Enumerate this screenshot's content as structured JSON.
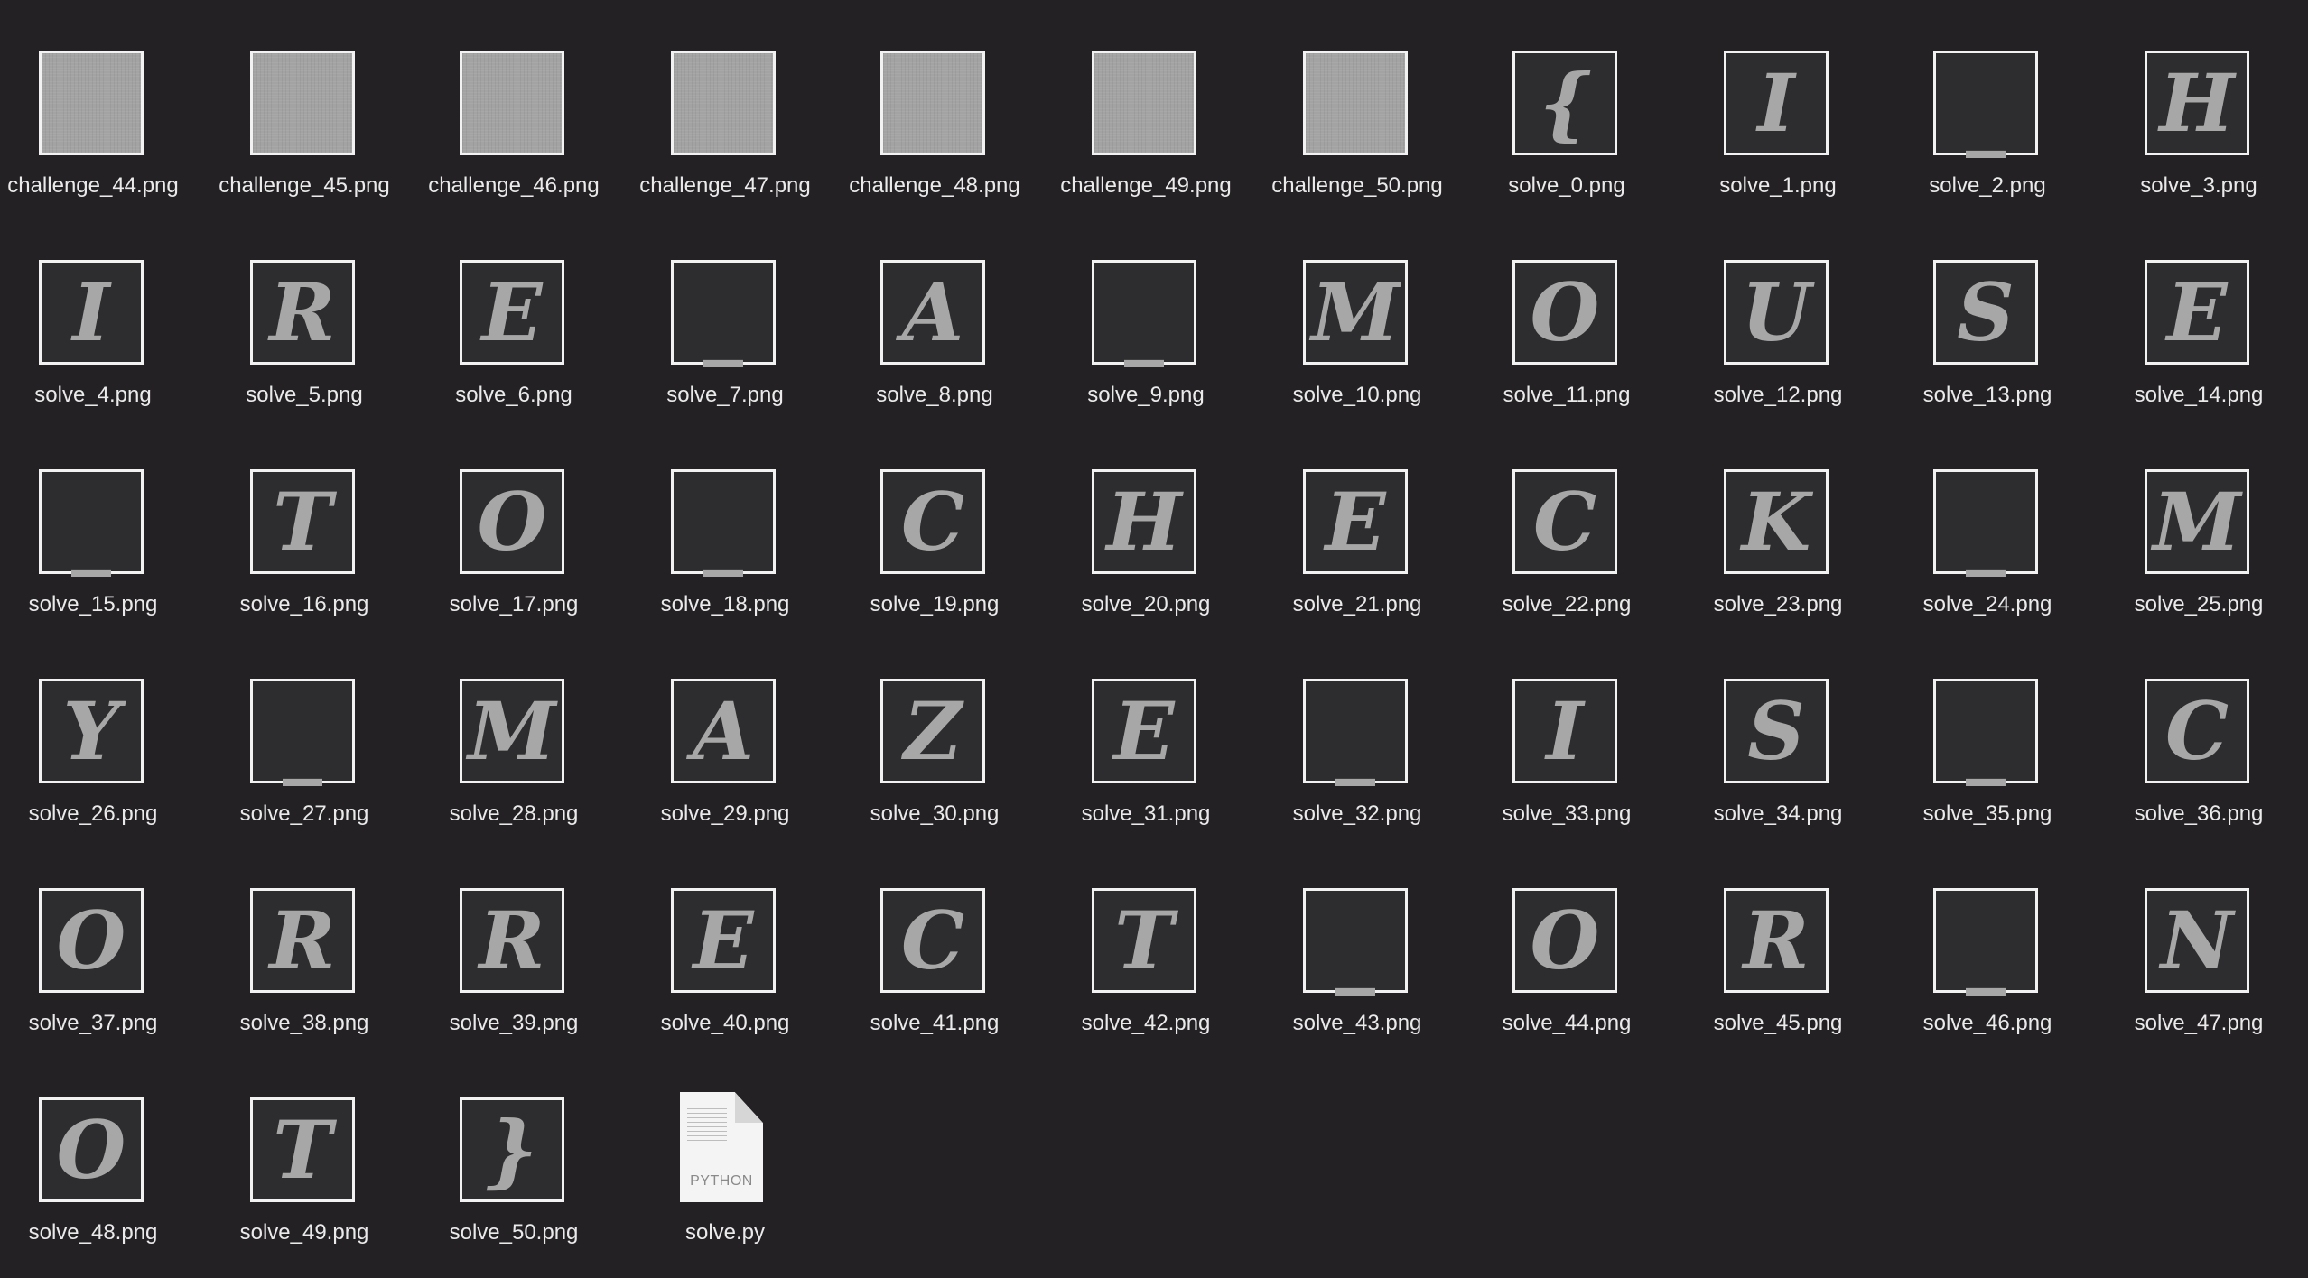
{
  "files": [
    {
      "name": "challenge_44.png",
      "kind": "noise"
    },
    {
      "name": "challenge_45.png",
      "kind": "noise"
    },
    {
      "name": "challenge_46.png",
      "kind": "noise"
    },
    {
      "name": "challenge_47.png",
      "kind": "noise"
    },
    {
      "name": "challenge_48.png",
      "kind": "noise"
    },
    {
      "name": "challenge_49.png",
      "kind": "noise"
    },
    {
      "name": "challenge_50.png",
      "kind": "noise"
    },
    {
      "name": "solve_0.png",
      "kind": "letter",
      "glyph": "{"
    },
    {
      "name": "solve_1.png",
      "kind": "letter",
      "glyph": "I"
    },
    {
      "name": "solve_2.png",
      "kind": "letter",
      "glyph": "_"
    },
    {
      "name": "solve_3.png",
      "kind": "letter",
      "glyph": "H"
    },
    {
      "name": "solve_4.png",
      "kind": "letter",
      "glyph": "I"
    },
    {
      "name": "solve_5.png",
      "kind": "letter",
      "glyph": "R"
    },
    {
      "name": "solve_6.png",
      "kind": "letter",
      "glyph": "E"
    },
    {
      "name": "solve_7.png",
      "kind": "letter",
      "glyph": "_"
    },
    {
      "name": "solve_8.png",
      "kind": "letter",
      "glyph": "A"
    },
    {
      "name": "solve_9.png",
      "kind": "letter",
      "glyph": "_"
    },
    {
      "name": "solve_10.png",
      "kind": "letter",
      "glyph": "M"
    },
    {
      "name": "solve_11.png",
      "kind": "letter",
      "glyph": "O"
    },
    {
      "name": "solve_12.png",
      "kind": "letter",
      "glyph": "U"
    },
    {
      "name": "solve_13.png",
      "kind": "letter",
      "glyph": "S"
    },
    {
      "name": "solve_14.png",
      "kind": "letter",
      "glyph": "E"
    },
    {
      "name": "solve_15.png",
      "kind": "letter",
      "glyph": "_"
    },
    {
      "name": "solve_16.png",
      "kind": "letter",
      "glyph": "T"
    },
    {
      "name": "solve_17.png",
      "kind": "letter",
      "glyph": "O"
    },
    {
      "name": "solve_18.png",
      "kind": "letter",
      "glyph": "_"
    },
    {
      "name": "solve_19.png",
      "kind": "letter",
      "glyph": "C"
    },
    {
      "name": "solve_20.png",
      "kind": "letter",
      "glyph": "H"
    },
    {
      "name": "solve_21.png",
      "kind": "letter",
      "glyph": "E"
    },
    {
      "name": "solve_22.png",
      "kind": "letter",
      "glyph": "C"
    },
    {
      "name": "solve_23.png",
      "kind": "letter",
      "glyph": "K"
    },
    {
      "name": "solve_24.png",
      "kind": "letter",
      "glyph": "_"
    },
    {
      "name": "solve_25.png",
      "kind": "letter",
      "glyph": "M"
    },
    {
      "name": "solve_26.png",
      "kind": "letter",
      "glyph": "Y"
    },
    {
      "name": "solve_27.png",
      "kind": "letter",
      "glyph": "_"
    },
    {
      "name": "solve_28.png",
      "kind": "letter",
      "glyph": "M"
    },
    {
      "name": "solve_29.png",
      "kind": "letter",
      "glyph": "A"
    },
    {
      "name": "solve_30.png",
      "kind": "letter",
      "glyph": "Z"
    },
    {
      "name": "solve_31.png",
      "kind": "letter",
      "glyph": "E"
    },
    {
      "name": "solve_32.png",
      "kind": "letter",
      "glyph": "_"
    },
    {
      "name": "solve_33.png",
      "kind": "letter",
      "glyph": "I"
    },
    {
      "name": "solve_34.png",
      "kind": "letter",
      "glyph": "S"
    },
    {
      "name": "solve_35.png",
      "kind": "letter",
      "glyph": "_"
    },
    {
      "name": "solve_36.png",
      "kind": "letter",
      "glyph": "C"
    },
    {
      "name": "solve_37.png",
      "kind": "letter",
      "glyph": "O"
    },
    {
      "name": "solve_38.png",
      "kind": "letter",
      "glyph": "R"
    },
    {
      "name": "solve_39.png",
      "kind": "letter",
      "glyph": "R"
    },
    {
      "name": "solve_40.png",
      "kind": "letter",
      "glyph": "E"
    },
    {
      "name": "solve_41.png",
      "kind": "letter",
      "glyph": "C"
    },
    {
      "name": "solve_42.png",
      "kind": "letter",
      "glyph": "T"
    },
    {
      "name": "solve_43.png",
      "kind": "letter",
      "glyph": "_"
    },
    {
      "name": "solve_44.png",
      "kind": "letter",
      "glyph": "O"
    },
    {
      "name": "solve_45.png",
      "kind": "letter",
      "glyph": "R"
    },
    {
      "name": "solve_46.png",
      "kind": "letter",
      "glyph": "_"
    },
    {
      "name": "solve_47.png",
      "kind": "letter",
      "glyph": "N"
    },
    {
      "name": "solve_48.png",
      "kind": "letter",
      "glyph": "O"
    },
    {
      "name": "solve_49.png",
      "kind": "letter",
      "glyph": "T"
    },
    {
      "name": "solve_50.png",
      "kind": "letter",
      "glyph": "}"
    },
    {
      "name": "solve.py",
      "kind": "python",
      "badge": "PYTHON",
      "icon": "python-file-icon"
    }
  ],
  "colors": {
    "background": "#242125",
    "noise_fill": "#a3a3a3",
    "letter_fill": "#2d2d2f",
    "glyph": "#a7a7a7",
    "border": "#f2f2f2",
    "label": "#eaeaea"
  }
}
